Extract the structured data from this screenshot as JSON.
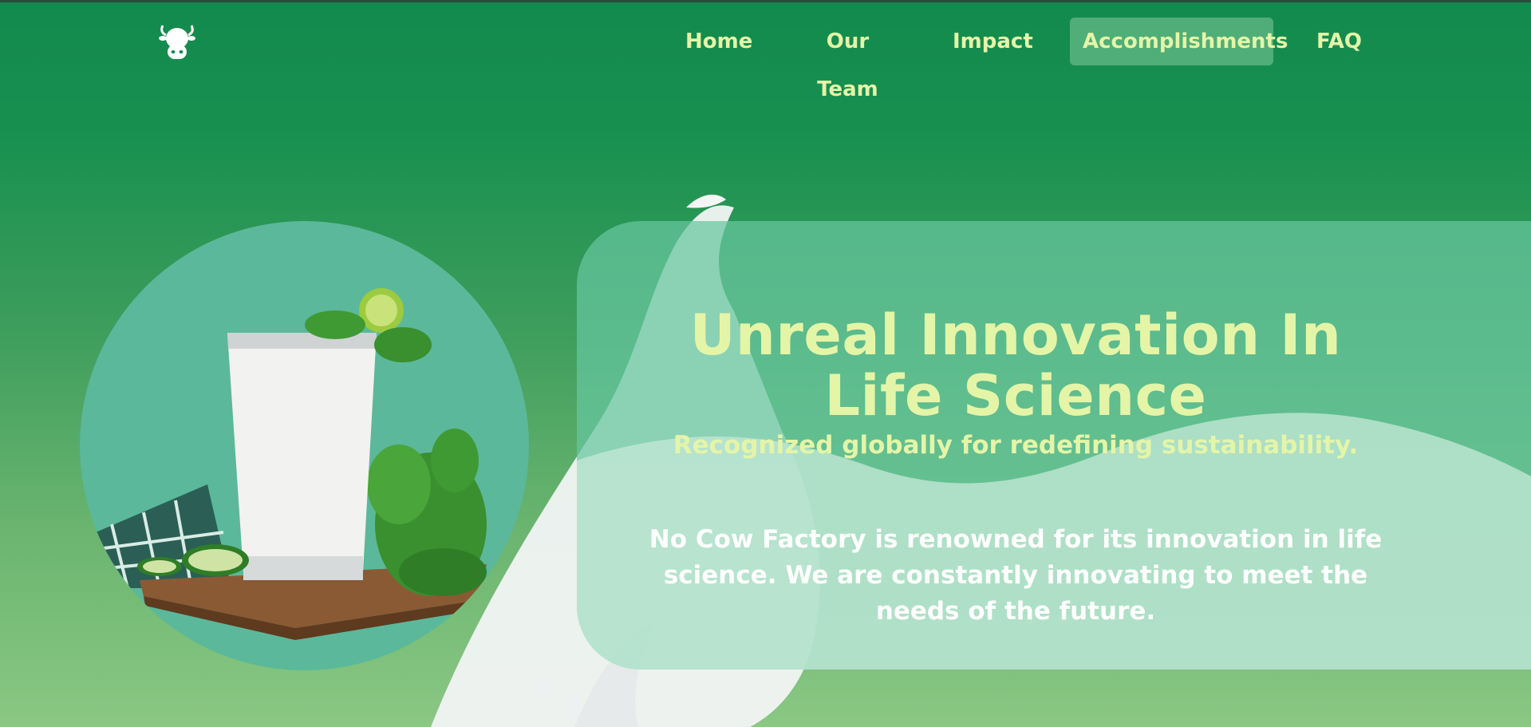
{
  "brand": {
    "logo_icon": "cow-head-icon"
  },
  "nav": {
    "items": [
      {
        "label": "Home",
        "active": false
      },
      {
        "label": "Our Team",
        "active": false
      },
      {
        "label": "Impact",
        "active": false
      },
      {
        "label": "Accomplishments",
        "active": true
      },
      {
        "label": "FAQ",
        "active": false
      }
    ]
  },
  "hero": {
    "title": "Unreal Innovation In Life Science",
    "subtitle": "Recognized globally for redefining sustainability.",
    "body": "No Cow Factory is renowned for its innovation in life science. We are constantly innovating to meet the needs of the future."
  },
  "colors": {
    "background_top": "#138a4e",
    "background_bottom": "#8ac884",
    "accent_text": "#e4f5a8",
    "body_text": "#ffffff",
    "card": "#66c6a0",
    "circle": "#5bb89a"
  }
}
